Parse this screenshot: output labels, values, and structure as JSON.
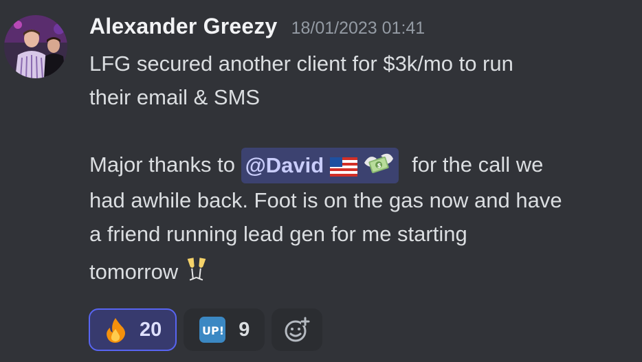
{
  "message": {
    "author": "Alexander Greezy",
    "timestamp": "18/01/2023 01:41",
    "line1": "LFG secured another client for $3k/mo to run",
    "line2": "their email & SMS",
    "para2_before": "Major thanks to",
    "mention": "@David",
    "para2_after": "for the call we",
    "line4": "had awhile back. Foot is on the gas now and have",
    "line5": "a friend running lead gen for me starting",
    "line6": "tomorrow"
  },
  "emoji_icons": [
    "us-flag-icon",
    "money-with-wings-icon",
    "champagne-glasses-icon"
  ],
  "reactions": [
    {
      "icon": "fire-icon",
      "count": "20",
      "reacted": true
    },
    {
      "icon": "up-button-icon",
      "count": "9",
      "reacted": false
    }
  ],
  "colors": {
    "background": "#313338",
    "username": "#f2f3f5",
    "timestamp": "#949ba4",
    "text": "#dbdee1",
    "mention_bg": "#3c4270",
    "mention_text": "#c9cdfb",
    "reaction_active_border": "#5865f2"
  }
}
